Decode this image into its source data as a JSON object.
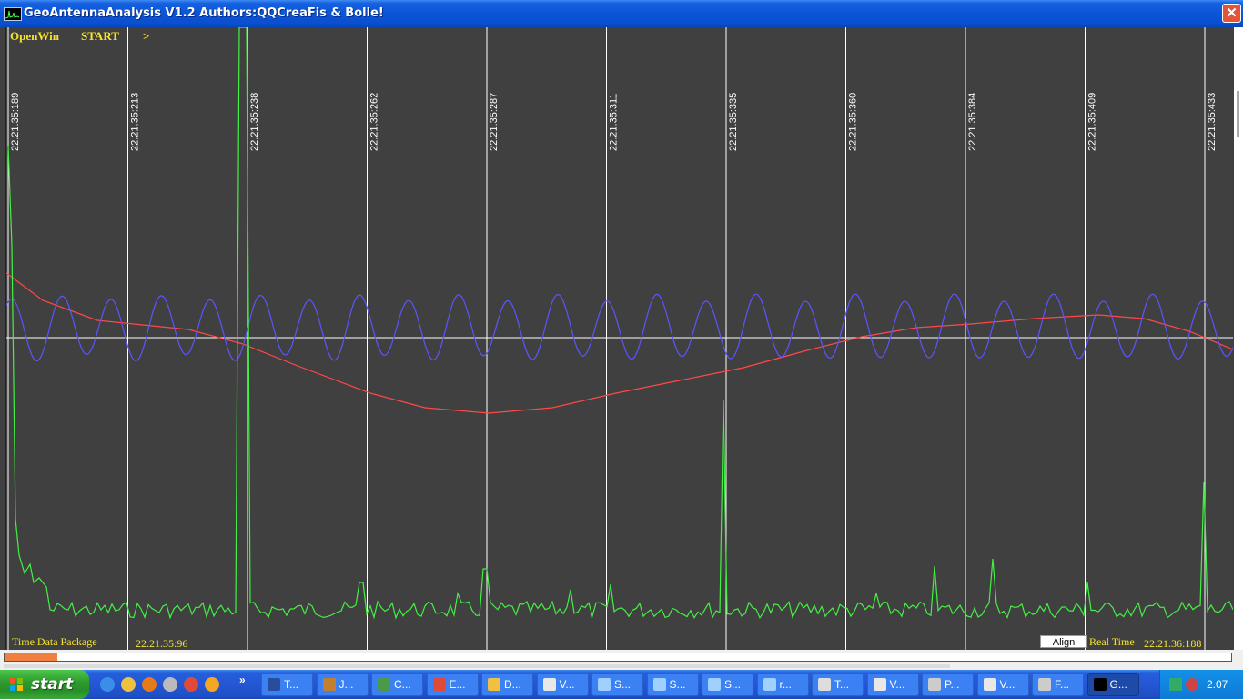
{
  "window": {
    "title": "GeoAntennaAnalysis V1.2 Authors:QQCreaFis & Bolle!",
    "close": "✕"
  },
  "menu": {
    "openwin": "OpenWin",
    "start": "START",
    "next": ">"
  },
  "timestamps": [
    "22.21.35:189",
    "22.21.35:213",
    "22.21.35:238",
    "22.21.35:262",
    "22.21.35:287",
    "22.21.35:311",
    "22.21.35:335",
    "22.21.35:360",
    "22.21.35:384",
    "22.21.35:409",
    "22.21.35:433"
  ],
  "bottom": {
    "package_label": "Time Data Package",
    "package_time": "22.21.35:96",
    "align": "Align",
    "realtime_label": "Real Time",
    "realtime_value": "22.21.36:188"
  },
  "colors": {
    "background": "#404040",
    "grid": "#ffffff",
    "blue": "#5a55ff",
    "red": "#ff4848",
    "green": "#44f044",
    "yellow": "#f7e42a"
  },
  "scrollbar": {
    "progress": 0.043
  },
  "taskbar": {
    "start": "start",
    "quick_launch": [
      "ie-icon",
      "folder-icon",
      "firefox-icon",
      "media-player-icon",
      "chrome-icon",
      "messenger-icon"
    ],
    "overflow": "»",
    "tasks": [
      {
        "label": "T...",
        "icon": "floppy-icon",
        "color": "#2a4c9c"
      },
      {
        "label": "J...",
        "icon": "gear-icon",
        "color": "#c08030"
      },
      {
        "label": "C...",
        "icon": "wireless-icon",
        "color": "#4a9a4a"
      },
      {
        "label": "E...",
        "icon": "chrome-icon",
        "color": "#e04a3a"
      },
      {
        "label": "D...",
        "icon": "folder-icon",
        "color": "#f0c040"
      },
      {
        "label": "V...",
        "icon": "file-icon",
        "color": "#e8e8e8"
      },
      {
        "label": "S...",
        "icon": "document-icon",
        "color": "#9fd0ff"
      },
      {
        "label": "S...",
        "icon": "document-icon",
        "color": "#9fd0ff"
      },
      {
        "label": "S...",
        "icon": "document-icon",
        "color": "#9fd0ff"
      },
      {
        "label": "r...",
        "icon": "document-icon",
        "color": "#9fd0ff"
      },
      {
        "label": "T...",
        "icon": "terminal-icon",
        "color": "#dddddd"
      },
      {
        "label": "V...",
        "icon": "file-icon",
        "color": "#e8e8e8"
      },
      {
        "label": "P...",
        "icon": "tool-icon",
        "color": "#cccccc"
      },
      {
        "label": "V...",
        "icon": "file-icon",
        "color": "#e8e8e8"
      },
      {
        "label": "F...",
        "icon": "tool-icon",
        "color": "#cccccc"
      },
      {
        "label": "G...",
        "icon": "app-graph-icon",
        "color": "#000000",
        "active": true
      }
    ],
    "clock": "2.07"
  }
}
